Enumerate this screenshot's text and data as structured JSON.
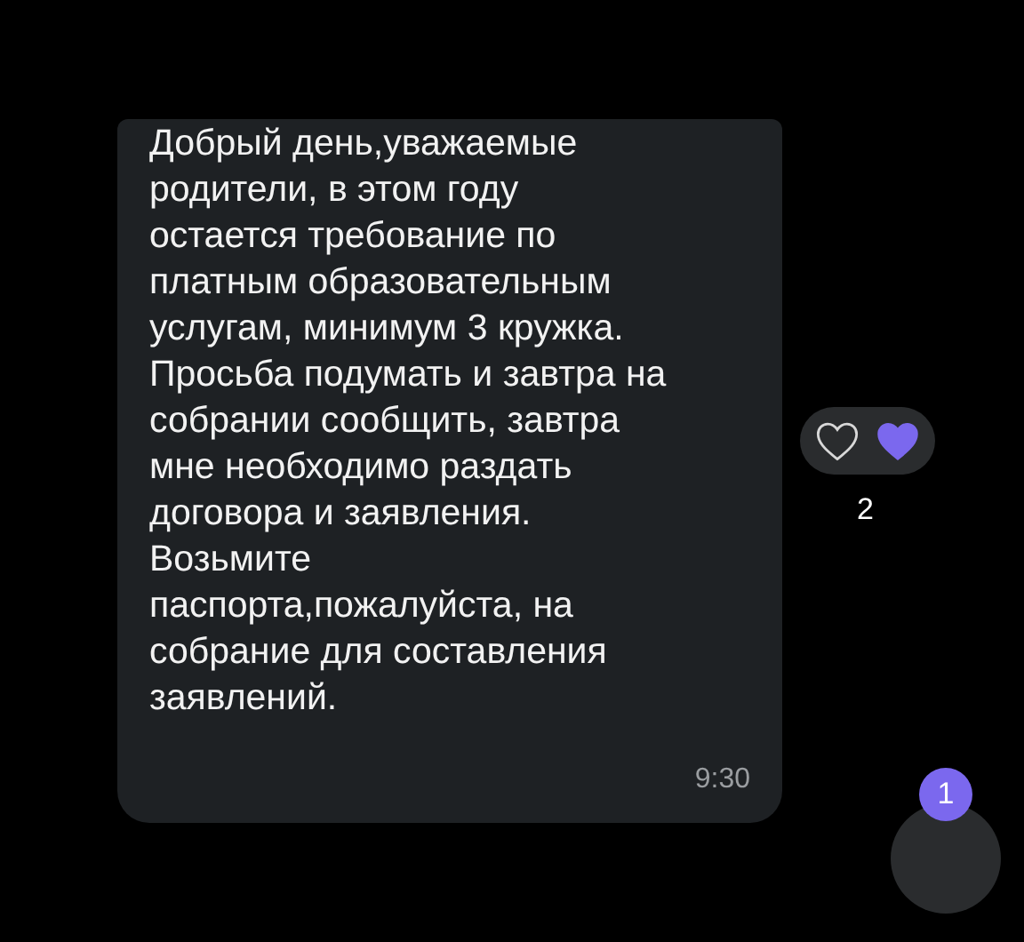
{
  "message": {
    "text": "Добрый день,уважаемые\nродители, в этом году\nостается требование по\nплатным образовательным\nуслугам, минимум 3 кружка.\nПросьба подумать и завтра на\nсобрании сообщить, завтра\nмне необходимо раздать\nдоговора и заявления.\nВозьмите\nпаспорта,пожалуйста, на\nсобрание для составления\nзаявлений.",
    "time": "9:30"
  },
  "reactions": {
    "options": [
      {
        "selected": false
      },
      {
        "selected": true
      }
    ],
    "count": "2"
  },
  "scroll_button": {
    "badge": "1"
  }
}
